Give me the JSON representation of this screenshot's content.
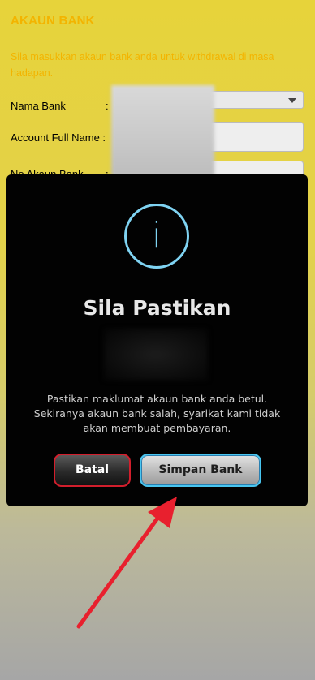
{
  "form": {
    "title": "AKAUN BANK",
    "note": "Sila masukkan akaun bank anda untuk withdrawal di masa hadapan.",
    "fields": [
      {
        "label": "Nama Bank",
        "colon": ":"
      },
      {
        "label": "Account Full Name :",
        "colon": ""
      },
      {
        "label": "No Akaun Bank",
        "colon": ":"
      }
    ]
  },
  "modal": {
    "icon": "info-icon",
    "icon_glyph": "i",
    "title": "Sila Pastikan",
    "message_line1": "Pastikan maklumat akaun bank anda betul.",
    "message_line2": "Sekiranya akaun bank salah, syarikat kami tidak",
    "message_line3": "akan membuat pembayaran.",
    "cancel_label": "Batal",
    "save_label": "Simpan Bank"
  },
  "colors": {
    "accent": "#f3b400",
    "info": "#7fd3f2",
    "cancel_border": "#d21e2c",
    "save_border": "#49c5ef",
    "annotation_arrow": "#e8202e"
  }
}
